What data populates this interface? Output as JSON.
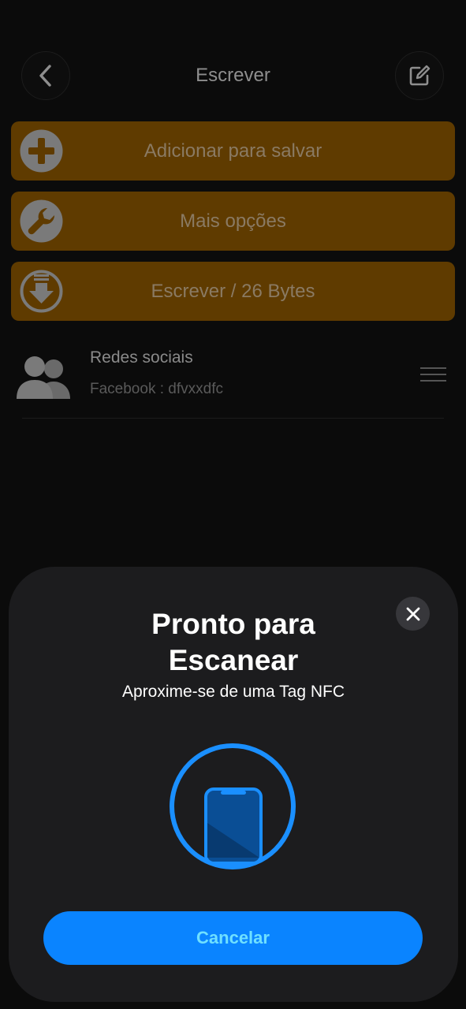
{
  "header": {
    "title": "Escrever",
    "back_icon": "chevron-left-icon",
    "edit_icon": "edit-square-icon"
  },
  "actions": [
    {
      "label": "Adicionar para salvar",
      "icon": "plus-circle-icon"
    },
    {
      "label": "Mais opções",
      "icon": "wrench-icon"
    },
    {
      "label": "Escrever / 26 Bytes",
      "icon": "download-circle-icon"
    }
  ],
  "record": {
    "title": "Redes sociais",
    "subtitle": "Facebook : dfvxxdfc",
    "icon": "people-icon",
    "handle_icon": "drag-handle-icon"
  },
  "sheet": {
    "title_line1": "Pronto para",
    "title_line2": "Escanear",
    "subtitle": "Aproxime-se de uma Tag NFC",
    "cancel_label": "Cancelar",
    "close_icon": "close-icon",
    "illustration_icon": "phone-scan-icon"
  },
  "colors": {
    "action_bg": "#5f3b00",
    "accent_blue": "#0a84ff",
    "sheet_bg": "#1c1c1e"
  }
}
